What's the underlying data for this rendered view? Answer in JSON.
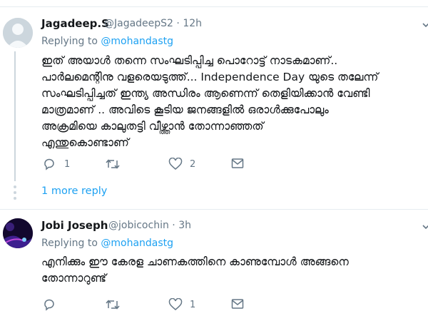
{
  "tweets": [
    {
      "name": "Jagadeep.S",
      "handle": "@JagadeepS2",
      "time": "12h",
      "replying_to_label": "Replying to",
      "replying_to_user": "@mohandastg",
      "lines": [
        "ഇത് അയാൾ തന്നെ സംഘടിപ്പിച്ച പൊറോട്ട് നാടകമാണ്..",
        "പാർലമെന്റിനു വളരെയടുത്ത്... Independence Day യുടെ തലേന്ന്",
        "സംഘടിപ്പിച്ചത് ഇന്ത്യ അന്ധിരം ആണെന്ന് തെളിയിക്കാൻ വേണ്ടി",
        "മാത്രമാണ് .. അവിടെ കൂടിയ ജനങ്ങളിൽ ഒരാൾക്കുപോലും",
        "അക്രമിയെ കാലുതട്ടി വീഴ്ത്താൻ  തോന്നാഞ്ഞത്",
        "എന്തുകൊണ്ടാണ്"
      ],
      "replies": "1",
      "retweets": "",
      "likes": "2"
    },
    {
      "name": "Jobi Joseph",
      "handle": "@jobicochin",
      "time": "3h",
      "replying_to_label": "Replying to",
      "replying_to_user": "@mohandastg",
      "lines": [
        "എനിക്കും ഈ കേരള ചാണകത്തിനെ കാണുമ്പോൾ അങ്ങനെ",
        "തോന്നാറുണ്ട്"
      ],
      "replies": "",
      "retweets": "",
      "likes": "1"
    }
  ],
  "more_replies_label": "1 more reply",
  "icons": {
    "reply": "reply-icon",
    "retweet": "retweet-icon",
    "like": "heart-icon",
    "dm": "envelope-icon",
    "caret": "chevron-down-icon"
  },
  "colors": {
    "link": "#1da1f2",
    "muted": "#657786",
    "text": "#14171a",
    "divider": "#e6ecf0"
  }
}
